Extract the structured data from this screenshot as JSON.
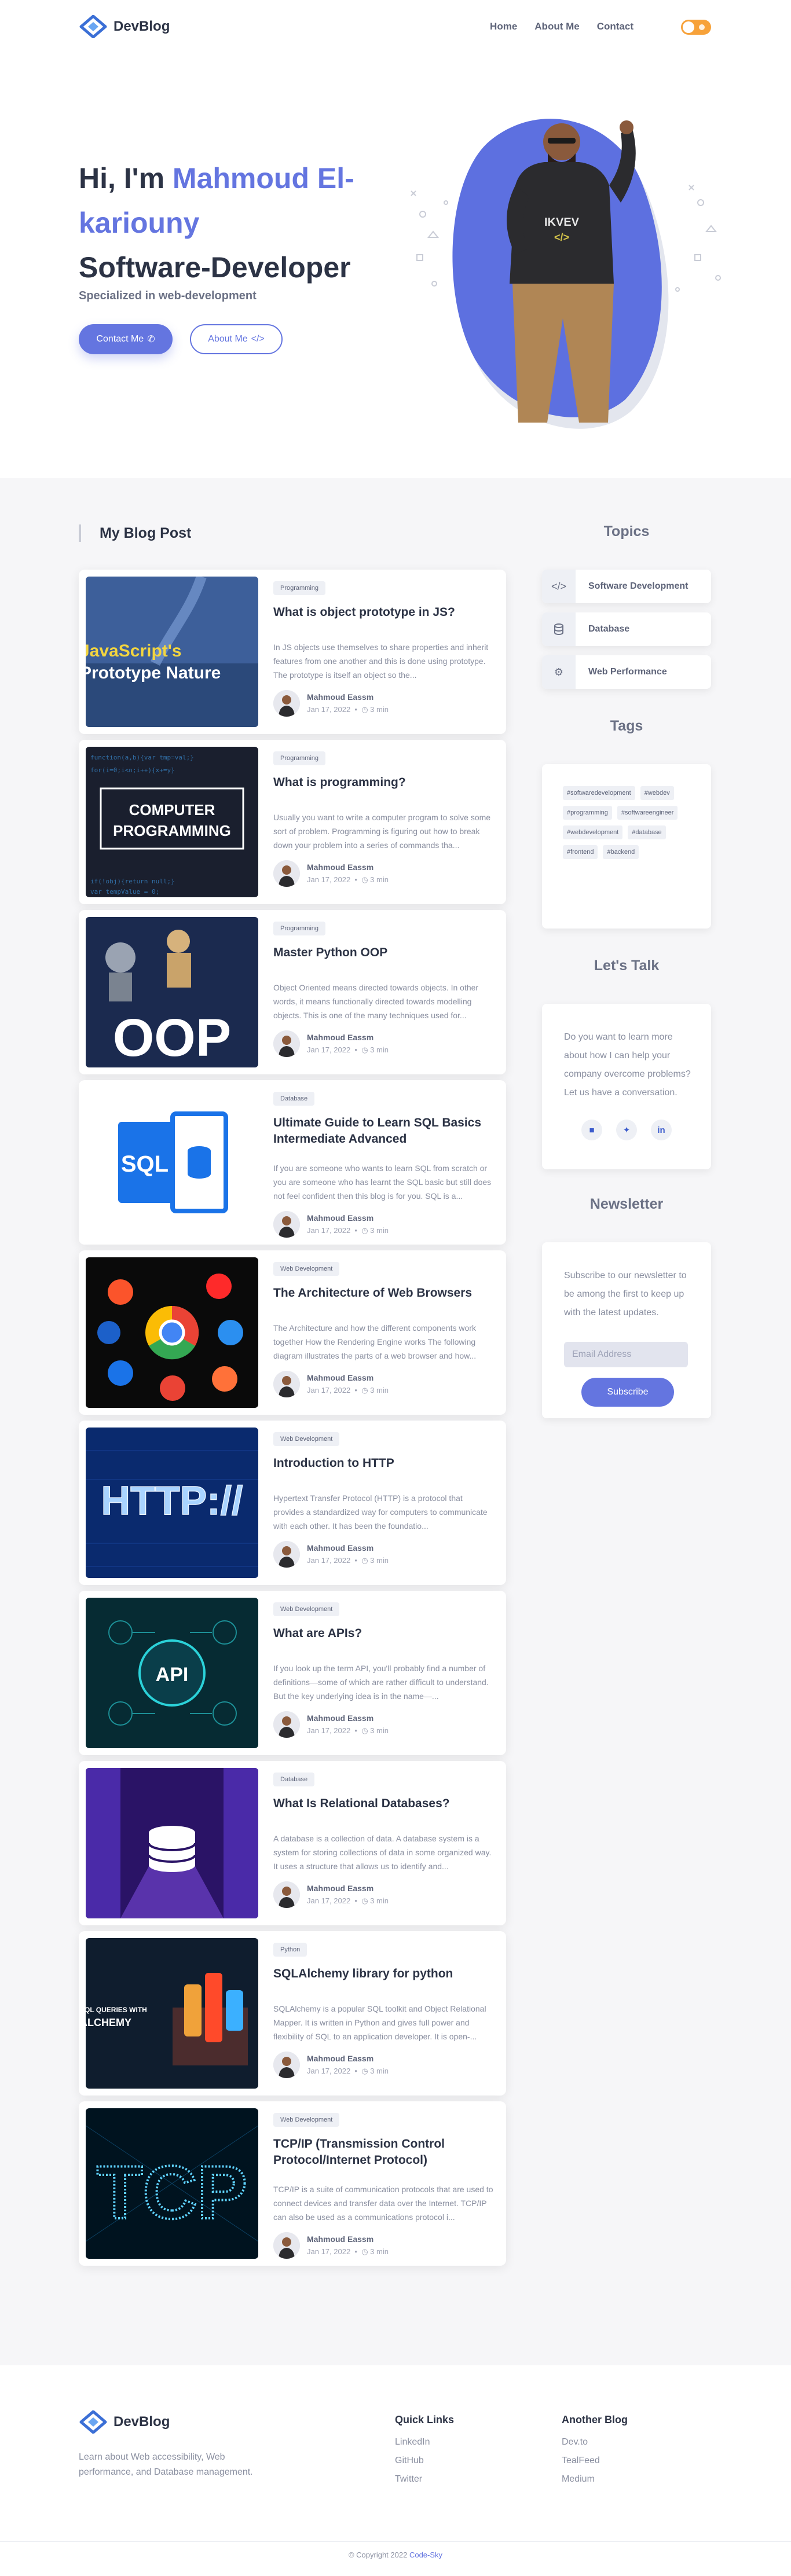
{
  "brand": {
    "name": "DevBlog",
    "accent": "#6475e0"
  },
  "nav": {
    "links": [
      "Home",
      "About Me",
      "Contact"
    ]
  },
  "hero": {
    "greeting": "Hi, I'm ",
    "name": "Mahmoud El-kariouny",
    "role": "Software-Developer",
    "subtitle": "Specialized in web-development",
    "contact_label": "Contact Me",
    "about_label": "About Me"
  },
  "main": {
    "title": "My Blog Post"
  },
  "posts": [
    {
      "tag": "Programming",
      "title": "What is object prototype in JS?",
      "excerpt": "In JS objects use themselves to share properties and inherit features from one another and this is done using prototype. The prototype is itself an object so the...",
      "author": "Mahmoud Eassm",
      "date": "Jan 17, 2022",
      "read": "3 min",
      "thumb_text": "JavaScript's Prototype Nature"
    },
    {
      "tag": "Programming",
      "title": "What is programming?",
      "excerpt": "Usually you want to write a computer program to solve some sort of problem. Programming is figuring out how to break down your problem into a series of commands tha...",
      "author": "Mahmoud Eassm",
      "date": "Jan 17, 2022",
      "read": "3 min",
      "thumb_text": "COMPUTER PROGRAMMING"
    },
    {
      "tag": "Programming",
      "title": "Master Python OOP",
      "excerpt": "Object Oriented means directed towards objects. In other words, it means functionally directed towards modelling objects. This is one of the many techniques used for...",
      "author": "Mahmoud Eassm",
      "date": "Jan 17, 2022",
      "read": "3 min",
      "thumb_text": "OOP"
    },
    {
      "tag": "Database",
      "title": "Ultimate Guide to Learn SQL Basics Intermediate Advanced",
      "excerpt": "If you are someone who wants to learn SQL from scratch or you are someone who has learnt the SQL basic but still does not feel confident then this blog is for you. SQL is a...",
      "author": "Mahmoud Eassm",
      "date": "Jan 17, 2022",
      "read": "3 min",
      "thumb_text": "SQL"
    },
    {
      "tag": "Web Development",
      "title": "The Architecture of Web Browsers",
      "excerpt": "The Architecture and how the different components work together How the Rendering Engine works The following diagram illustrates the parts of a web browser and how...",
      "author": "Mahmoud Eassm",
      "date": "Jan 17, 2022",
      "read": "3 min",
      "thumb_text": ""
    },
    {
      "tag": "Web Development",
      "title": "Introduction to HTTP",
      "excerpt": "Hypertext Transfer Protocol (HTTP) is a protocol that provides a standardized way for computers to communicate with each other. It has been the foundatio...",
      "author": "Mahmoud Eassm",
      "date": "Jan 17, 2022",
      "read": "3 min",
      "thumb_text": "HTTP://"
    },
    {
      "tag": "Web Development",
      "title": "What are APIs?",
      "excerpt": "If you look up the term API, you'll probably find a number of definitions—some of which are rather difficult to understand. But the key underlying idea is in the name—...",
      "author": "Mahmoud Eassm",
      "date": "Jan 17, 2022",
      "read": "3 min",
      "thumb_text": "API"
    },
    {
      "tag": "Database",
      "title": "What Is Relational Databases?",
      "excerpt": "A database is a collection of data. A database system is a system for storing collections of data in some organized way. It uses a structure that allows us to identify and...",
      "author": "Mahmoud Eassm",
      "date": "Jan 17, 2022",
      "read": "3 min",
      "thumb_text": ""
    },
    {
      "tag": "Python",
      "title": "SQLAlchemy library for python",
      "excerpt": "SQLAlchemy is a popular SQL toolkit and Object Relational Mapper. It is written in Python and gives full power and flexibility of SQL to an application developer. It is open-...",
      "author": "Mahmoud Eassm",
      "date": "Jan 17, 2022",
      "read": "3 min",
      "thumb_text": "SQL QUERIES WITH ALCHEMY"
    },
    {
      "tag": "Web Development",
      "title": "TCP/IP (Transmission Control Protocol/Internet Protocol)",
      "excerpt": "TCP/IP is a suite of communication protocols that are used to connect devices and transfer data over the Internet. TCP/IP can also be used as a communications protocol i...",
      "author": "Mahmoud Eassm",
      "date": "Jan 17, 2022",
      "read": "3 min",
      "thumb_text": "TCP"
    }
  ],
  "sidebar": {
    "topics_title": "Topics",
    "topics": [
      {
        "label": "Software Development",
        "icon": "code-icon"
      },
      {
        "label": "Database",
        "icon": "database-icon"
      },
      {
        "label": "Web Performance",
        "icon": "gear-icon"
      }
    ],
    "tags_title": "Tags",
    "tags": [
      "#softwaredevelopment",
      "#webdev",
      "#programming",
      "#softwareengineer",
      "#webdevelopment",
      "#database",
      "#frontend",
      "#backend"
    ],
    "talk_title": "Let's Talk",
    "talk_text": "Do you want to learn more about how I can help your company overcome problems? Let us have a conversation.",
    "socials": [
      "discord-icon",
      "twitter-icon",
      "linkedin-icon"
    ],
    "newsletter_title": "Newsletter",
    "newsletter_text": "Subscribe to our newsletter to be among the first to keep up with the latest updates.",
    "email_placeholder": "Email Address",
    "subscribe_label": "Subscribe"
  },
  "footer": {
    "description": "Learn about Web accessibility, Web performance, and Database management.",
    "quick_links_title": "Quick Links",
    "quick_links": [
      "LinkedIn",
      "GitHub",
      "Twitter"
    ],
    "another_blog_title": "Another Blog",
    "another_blog": [
      "Dev.to",
      "TealFeed",
      "Medium"
    ],
    "copyright": "© Copyright 2022 ",
    "copyright_link": "Code-Sky"
  }
}
